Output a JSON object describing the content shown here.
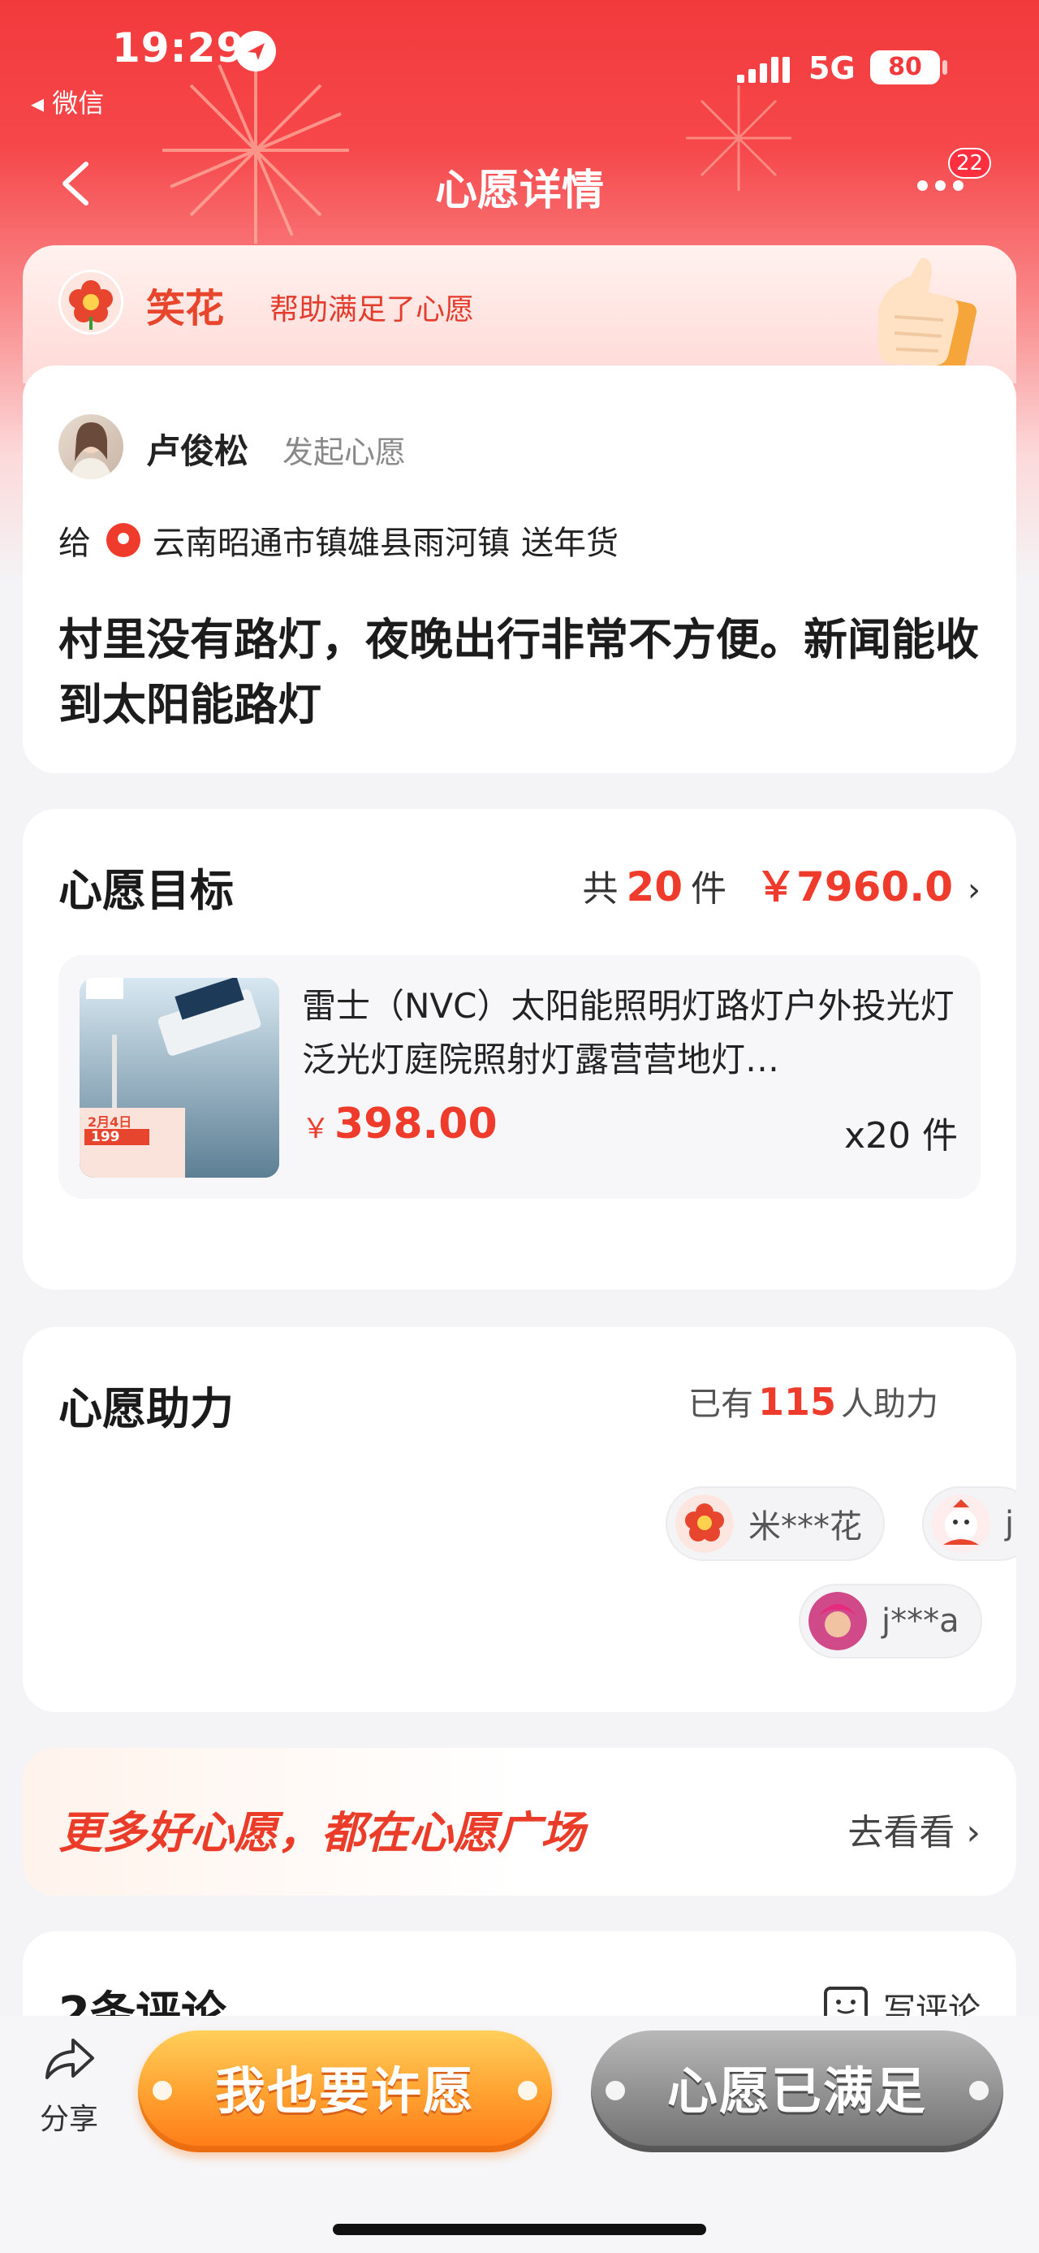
{
  "status_bar": {
    "time": "19:29",
    "back_app": "◂ 微信",
    "network": "5G",
    "battery": "80"
  },
  "nav": {
    "title": "心愿详情",
    "badge": "22"
  },
  "helper": {
    "name": "笑花",
    "text": "帮助满足了心愿"
  },
  "wish": {
    "author": "卢俊松",
    "action": "发起心愿",
    "to_prefix": "给",
    "location": "云南昭通市镇雄县雨河镇",
    "purpose": "送年货",
    "description": "村里没有路灯，夜晚出行非常不方便。新闻能收到太阳能路灯"
  },
  "goal": {
    "title": "心愿目标",
    "count_prefix": "共",
    "count": "20",
    "count_unit": "件",
    "total": "￥7960.0",
    "arrow": "›",
    "product": {
      "title": "雷士（NVC）太阳能照明灯路灯户外投光灯泛光灯庭院照射灯露营营地灯…",
      "currency": "￥",
      "price": "398.00",
      "quantity": "x20 件",
      "img_text_1": "2月4日",
      "img_text_2": "199"
    }
  },
  "assist": {
    "title": "心愿助力",
    "prefix": "已有",
    "count": "115",
    "suffix": "人助力",
    "chips": [
      {
        "name": "米***花",
        "color": "#e8452f"
      },
      {
        "name": "j",
        "color": "#f0b7b0"
      },
      {
        "name": "j***a",
        "color": "#d04a8a"
      }
    ]
  },
  "plaza": {
    "text": "更多好心愿，都在心愿广场",
    "link": "去看看 ›"
  },
  "comments": {
    "title": "2条评论",
    "write": "写评论"
  },
  "bottom": {
    "share": "分享",
    "wish_button": "我也要许愿",
    "done_button": "心愿已满足"
  },
  "colors": {
    "primary_red": "#ef3b2b",
    "header_red": "#f23a3c",
    "orange": "#ff9f2e"
  }
}
